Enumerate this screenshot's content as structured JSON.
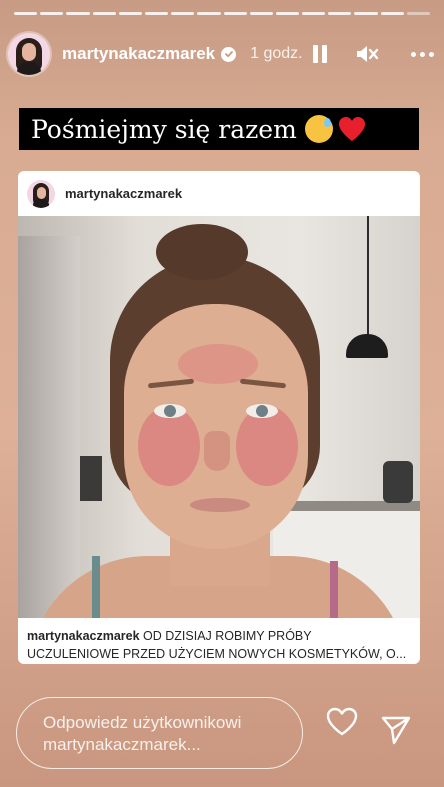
{
  "story": {
    "progress_segments": 16,
    "username": "martynakaczmarek",
    "time": "1 godz.",
    "caption": "Pośmiejmy się razem",
    "caption_emojis": [
      "sweat-smile-emoji",
      "red-heart-emoji"
    ]
  },
  "post": {
    "username": "martynakaczmarek",
    "caption_user": "martynakaczmarek",
    "caption_text_line1": " OD DZISIAJ ROBIMY PRÓBY",
    "caption_text_line2": "UCZULENIOWE PRZED UŻYCIEM NOWYCH KOSMETYKÓW, O..."
  },
  "reply": {
    "placeholder": "Odpowiedz użytkownikowi martynakaczmarek..."
  },
  "colors": {
    "background_top": "#c79b84",
    "background_mid": "#ddb097",
    "caption_bg": "#000000"
  },
  "icons": [
    "verified-badge-icon",
    "pause-icon",
    "mute-icon",
    "more-icon",
    "heart-icon",
    "send-icon"
  ]
}
